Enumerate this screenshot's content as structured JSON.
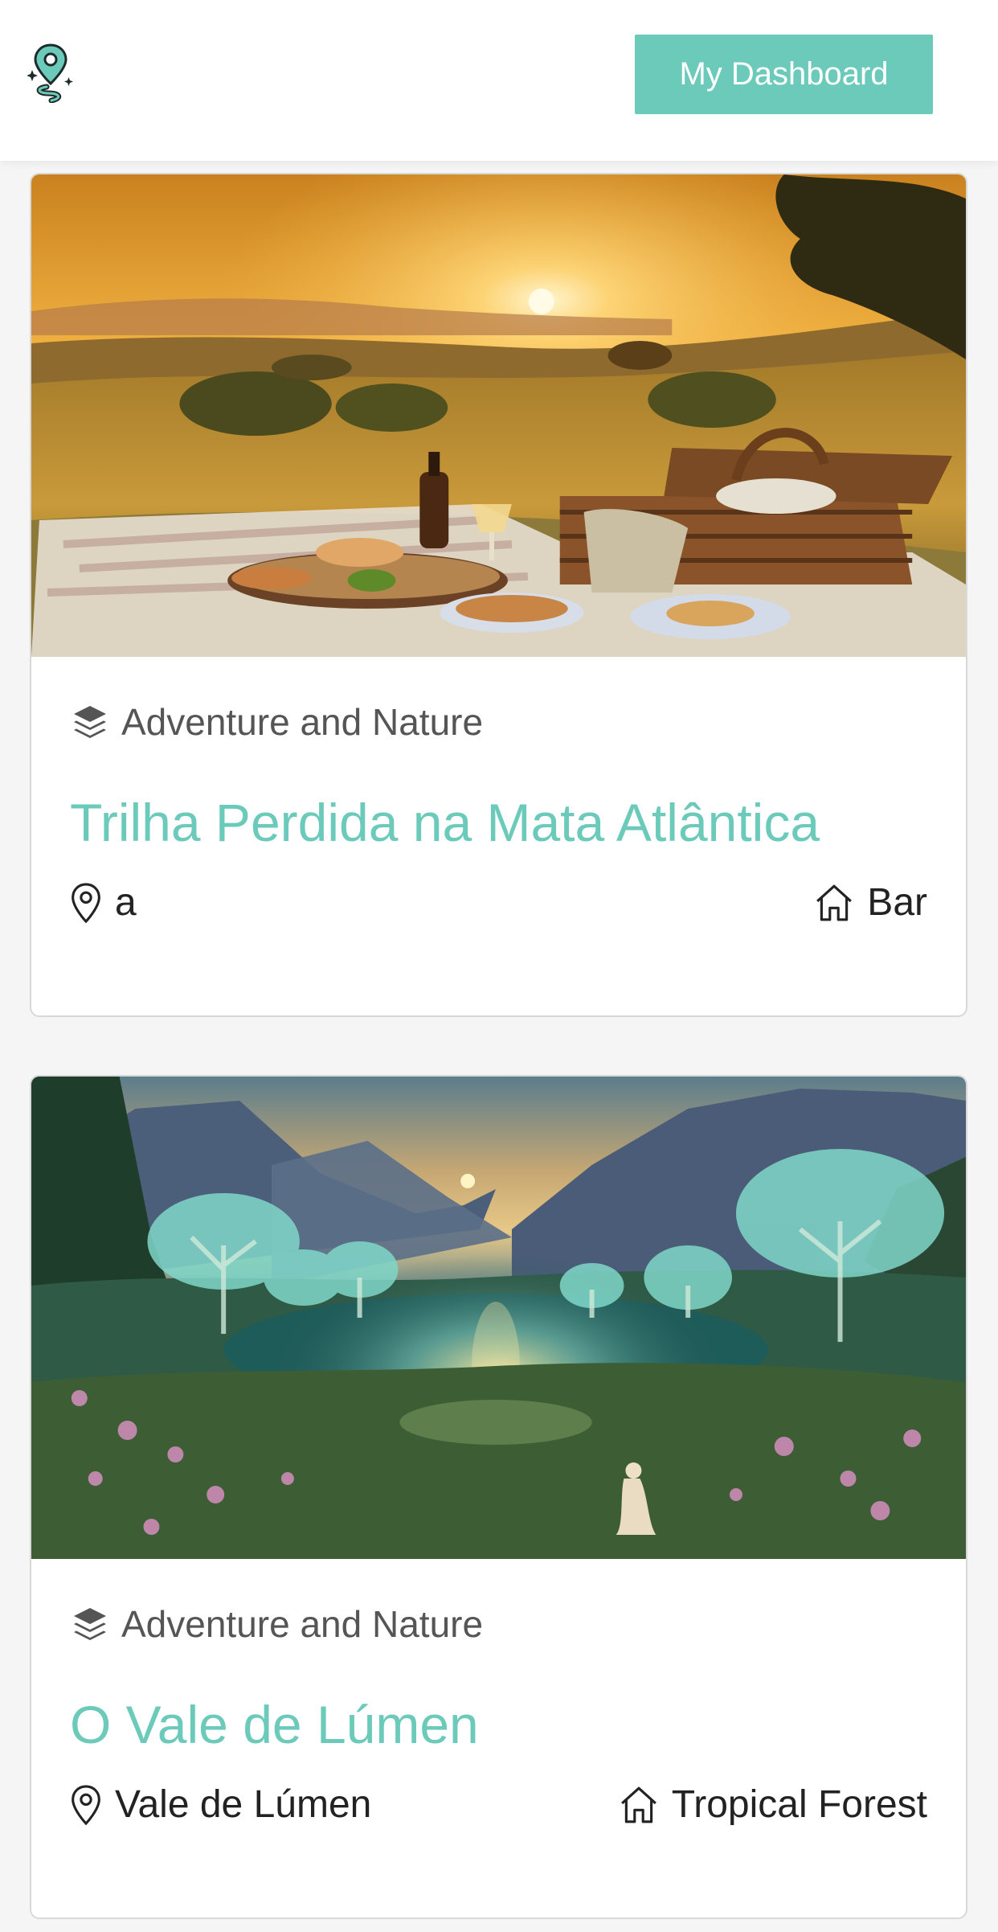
{
  "header": {
    "logo_icon": "map-pin-road-logo",
    "dashboard_label": "My Dashboard"
  },
  "events": [
    {
      "image": "sunset-picnic-meadow",
      "category": "Adventure and Nature",
      "title": "Trilha Perdida na Mata Atlântica",
      "location": "a",
      "venue": "Bar"
    },
    {
      "image": "glowing-forest-lake-valley",
      "category": "Adventure and Nature",
      "title": "O Vale de Lúmen",
      "location": "Vale de Lúmen",
      "venue": "Tropical Forest"
    }
  ],
  "colors": {
    "accent": "#6ccabb",
    "text": "#222222",
    "muted": "#555555"
  }
}
